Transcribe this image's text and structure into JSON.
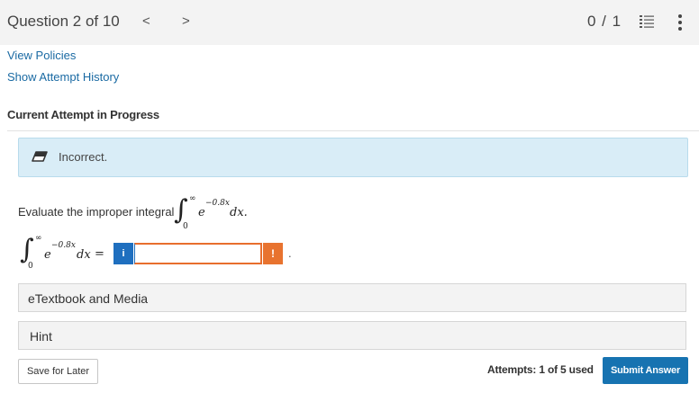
{
  "header": {
    "question_label": "Question 2 of 10",
    "prev_icon": "chevron-left-icon",
    "prev_glyph": "<",
    "next_icon": "chevron-right-icon",
    "next_glyph": ">",
    "score": "0 / 1",
    "list_icon": "numbered-list-icon",
    "more_icon": "vertical-dots-icon"
  },
  "links": {
    "view_policies": "View Policies",
    "attempt_history": "Show Attempt History"
  },
  "attempt": {
    "heading": "Current Attempt in Progress"
  },
  "alert": {
    "icon": "eraser-icon",
    "text": "Incorrect."
  },
  "question": {
    "prompt": "Evaluate the improper integral",
    "integrand": "e",
    "exponent": "−0.8x",
    "differential": "dx.",
    "lower_limit": "0",
    "upper_limit": "∞"
  },
  "answer": {
    "integrand": "e",
    "exponent": "−0.8x",
    "differential": "dx",
    "equals": "=",
    "lower_limit": "0",
    "upper_limit": "∞",
    "info_glyph": "i",
    "value": "",
    "warn_glyph": "!",
    "trailing": "."
  },
  "panels": {
    "etextbook": "eTextbook and Media",
    "hint": "Hint"
  },
  "footer": {
    "save_label": "Save for Later",
    "attempts_text": "Attempts: 1 of 5 used",
    "submit_label": "Submit Answer"
  },
  "colors": {
    "link": "#1a6aa3",
    "alert_bg": "#d9edf7",
    "warning": "#e8732f",
    "submit": "#1773b1"
  }
}
